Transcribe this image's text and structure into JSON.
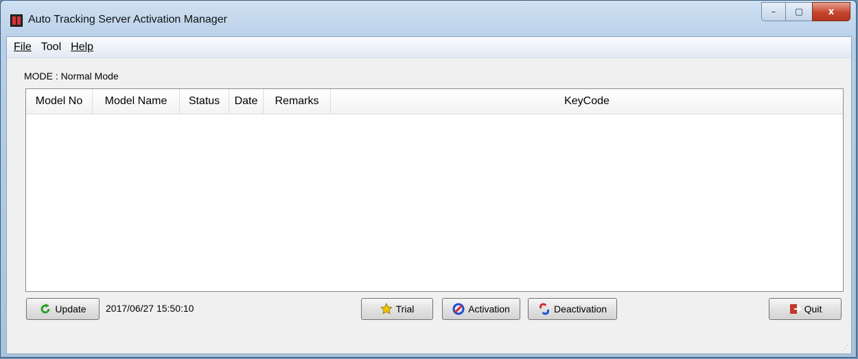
{
  "window": {
    "title": "Auto Tracking Server Activation Manager"
  },
  "window_controls": {
    "minimize": "–",
    "maximize": "▢",
    "close": "x"
  },
  "menu": [
    {
      "label": "File",
      "mnemonic": "F"
    },
    {
      "label": "Tool",
      "mnemonic": ""
    },
    {
      "label": "Help",
      "mnemonic": "H"
    }
  ],
  "mode_label": "MODE : Normal Mode",
  "table": {
    "columns": [
      "Model No",
      "Model Name",
      "Status",
      "Date",
      "Remarks",
      "KeyCode"
    ],
    "rows": []
  },
  "footer": {
    "update_label": "Update",
    "timestamp": "2017/06/27 15:50:10",
    "trial_label": "Trial",
    "activation_label": "Activation",
    "deactivation_label": "Deactivation",
    "quit_label": "Quit"
  },
  "icons": {
    "app": "app-icon",
    "update": "refresh-arrow-icon",
    "trial": "star-icon",
    "activation": "link-icon",
    "deactivation": "unlink-icon",
    "quit": "exit-door-icon"
  },
  "colors": {
    "accent_green": "#2e9e2a",
    "star_yellow": "#f2c300",
    "link_blue": "#1a4bd6",
    "link_red": "#d22a2a",
    "quit_red": "#c0392b"
  }
}
